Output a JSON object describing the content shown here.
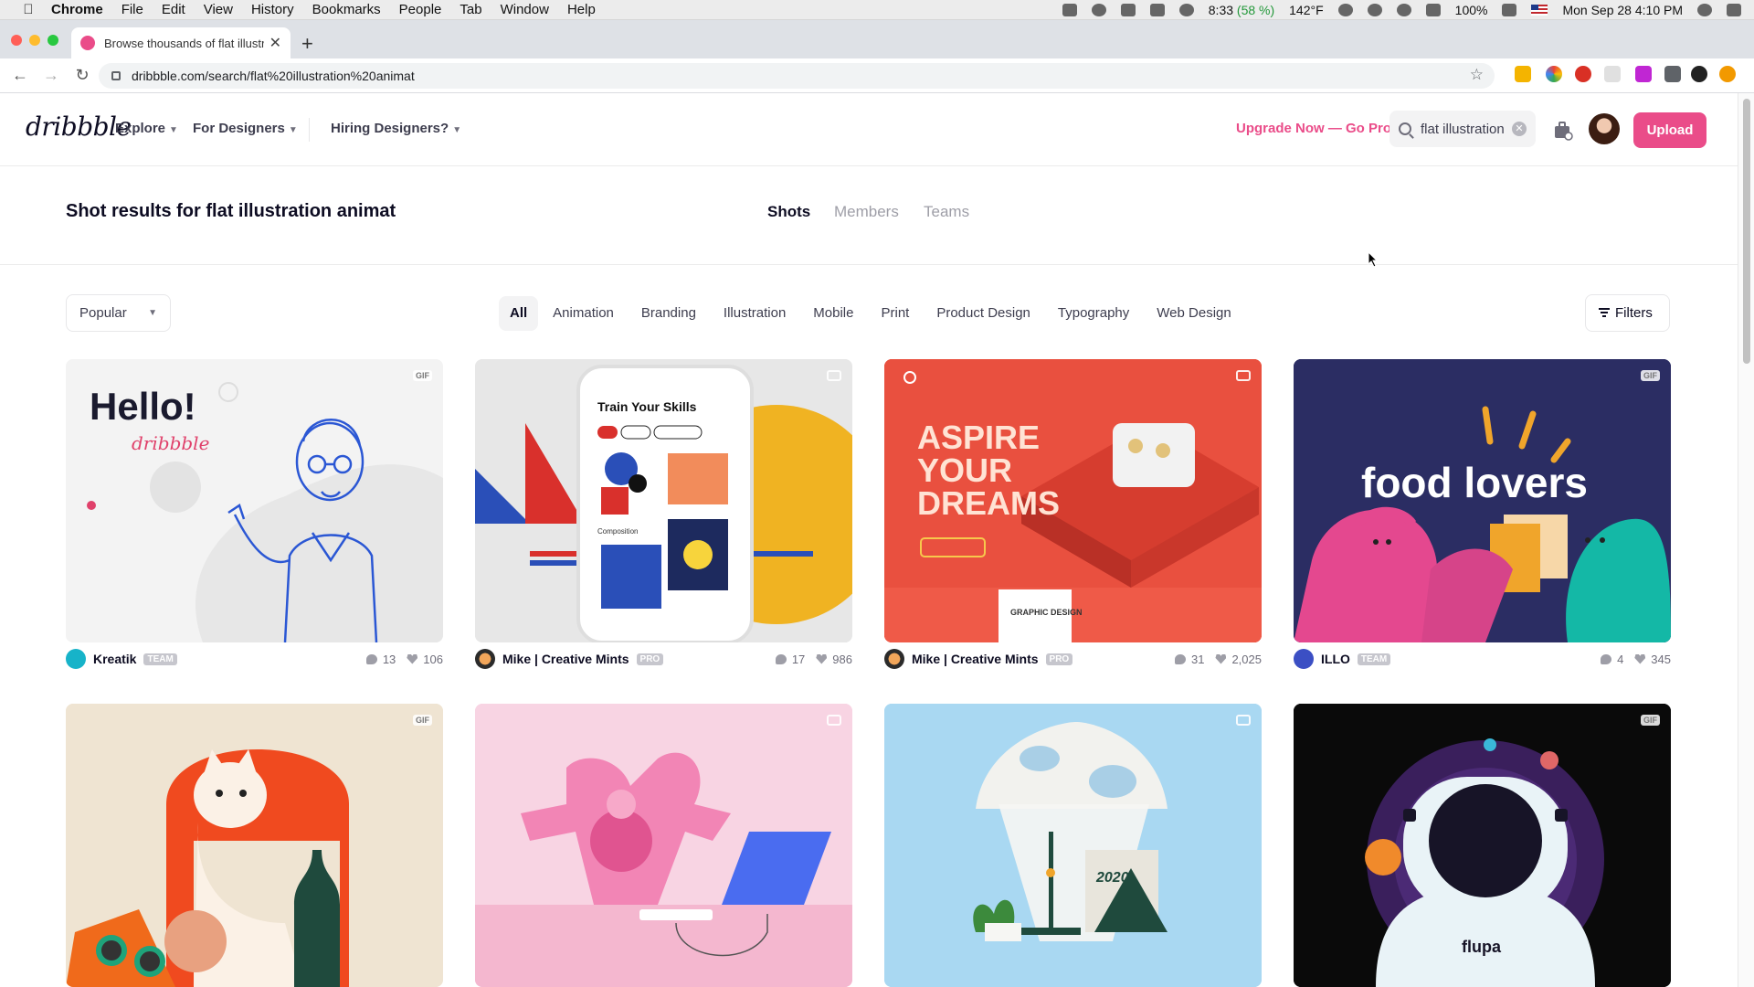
{
  "os_menubar": {
    "app": "Chrome",
    "menus": [
      "File",
      "Edit",
      "View",
      "History",
      "Bookmarks",
      "People",
      "Tab",
      "Window",
      "Help"
    ],
    "time_remaining": "8:33",
    "battery_pct_paren": "(58 %)",
    "temperature": "142°F",
    "battery": "100%",
    "datetime": "Mon Sep 28  4:10 PM"
  },
  "browser": {
    "tab_title": "Browse thousands of flat illustr",
    "url": "dribbble.com/search/flat%20illustration%20animat"
  },
  "header": {
    "logo": "dribbble",
    "nav": [
      "Explore",
      "For Designers",
      "Hiring Designers?"
    ],
    "upgrade": "Upgrade Now — Go Pro",
    "search_value": "flat illustration",
    "upload": "Upload"
  },
  "results": {
    "title": "Shot results for flat illustration animat",
    "tabs": [
      "Shots",
      "Members",
      "Teams"
    ]
  },
  "filters": {
    "sort": "Popular",
    "categories": [
      "All",
      "Animation",
      "Branding",
      "Illustration",
      "Mobile",
      "Print",
      "Product Design",
      "Typography",
      "Web Design"
    ],
    "filters_label": "Filters"
  },
  "shots": [
    {
      "author": "Kreatik",
      "tag": "TEAM",
      "comments": "13",
      "likes": "106",
      "badge": "GIF",
      "art_text": "Hello!",
      "art_sub": "dribbble"
    },
    {
      "author": "Mike | Creative Mints",
      "tag": "PRO",
      "comments": "17",
      "likes": "986",
      "badge": "video",
      "art_text": "Train Your Skills",
      "art_sub": "Composition"
    },
    {
      "author": "Mike | Creative Mints",
      "tag": "PRO",
      "comments": "31",
      "likes": "2,025",
      "badge": "video",
      "art_text": "ASPIRE YOUR DREAMS",
      "art_sub": "GRAPHIC DESIGN"
    },
    {
      "author": "ILLO",
      "tag": "TEAM",
      "comments": "4",
      "likes": "345",
      "badge": "GIF",
      "art_text": "food lovers",
      "art_sub": ""
    },
    {
      "badge": "GIF"
    },
    {
      "badge": "video"
    },
    {
      "badge": "video",
      "art_text": "2020"
    },
    {
      "badge": "GIF",
      "art_text": "flupa"
    }
  ],
  "colors": {
    "brand_pink": "#ea4c89",
    "text_dark": "#0d0c22",
    "text_muted": "#6e6d7a"
  }
}
